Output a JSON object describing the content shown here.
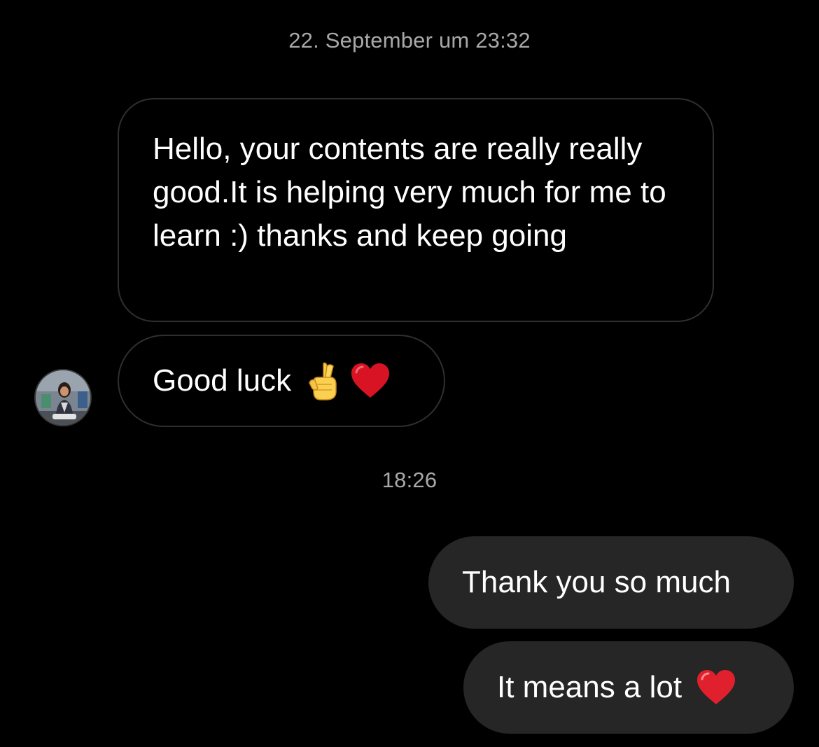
{
  "thread": {
    "timestamps": [
      "22. September um 23:32",
      "18:26"
    ],
    "messages": [
      {
        "direction": "incoming",
        "text": "Hello, your contents are really really good.It is helping very much for me to learn :) thanks and keep going"
      },
      {
        "direction": "incoming",
        "text": "Good luck",
        "emojis": [
          "crossed-fingers-icon",
          "heart-icon"
        ]
      },
      {
        "direction": "outgoing",
        "text": "Thank you so much"
      },
      {
        "direction": "outgoing",
        "text": "It means a lot",
        "emojis": [
          "heart-icon"
        ]
      }
    ]
  },
  "colors": {
    "background": "#000000",
    "incoming_border": "#2f2f2f",
    "outgoing_bubble": "#262626",
    "timestamp_text": "#a8a8a8",
    "heart_red": "#e0202c"
  }
}
